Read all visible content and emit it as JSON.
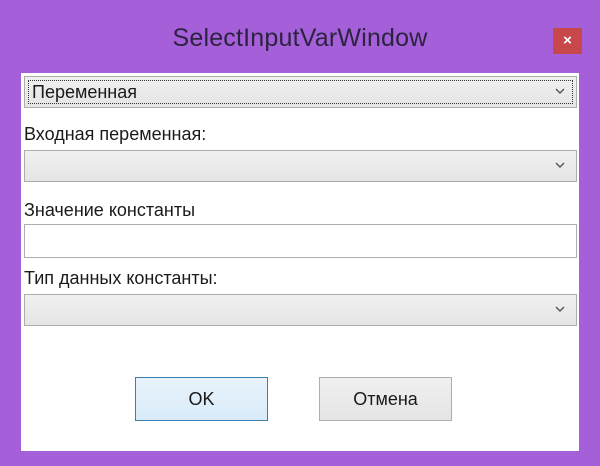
{
  "window": {
    "title": "SelectInputVarWindow",
    "close_label": "×"
  },
  "form": {
    "type_combo_value": "Переменная",
    "input_var_label": "Входная переменная:",
    "input_var_value": "",
    "const_value_label": "Значение константы",
    "const_value": "",
    "const_type_label": "Тип данных константы:",
    "const_type_value": ""
  },
  "buttons": {
    "ok_label": "OK",
    "cancel_label": "Отмена"
  },
  "colors": {
    "frame": "#a45fd9",
    "close_button": "#c7474b",
    "client_background": "#ffffff"
  }
}
